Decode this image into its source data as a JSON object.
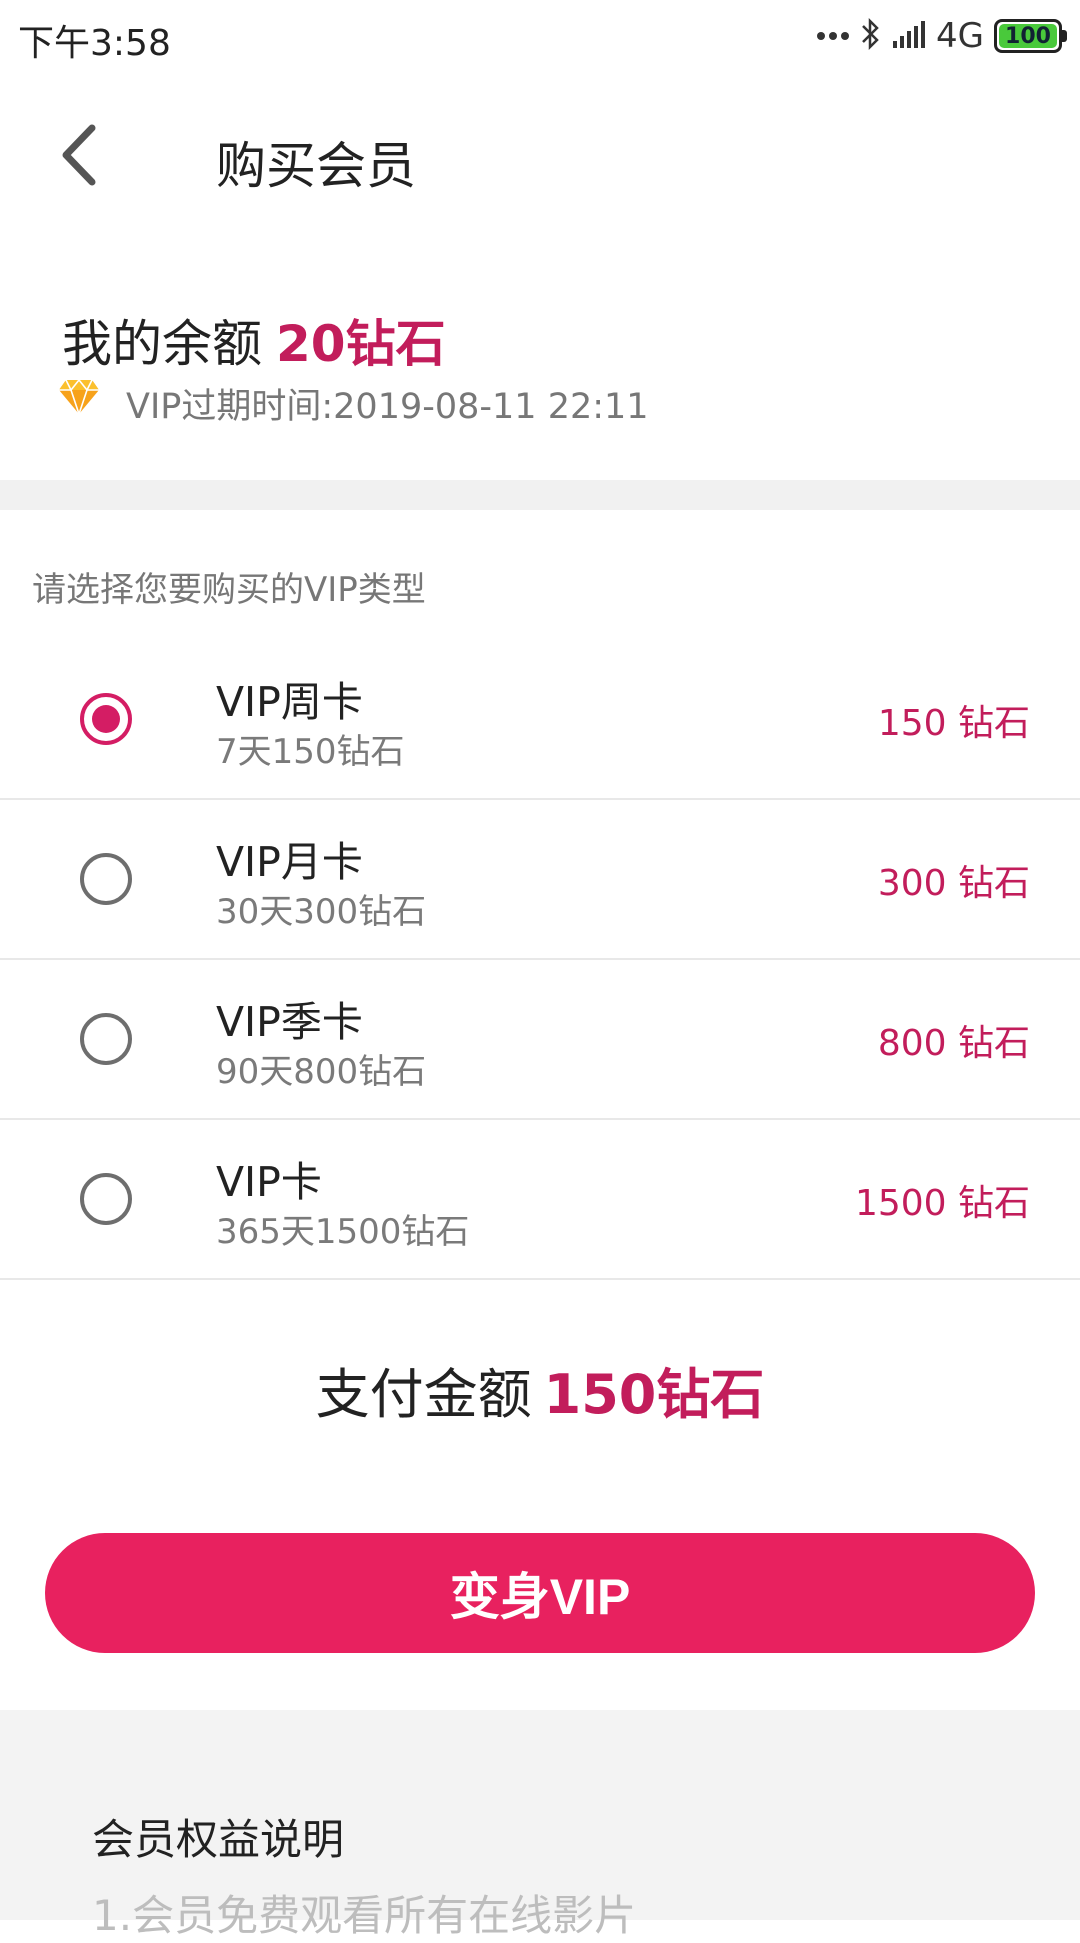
{
  "status_bar": {
    "time": "下午3:58",
    "network": "4G",
    "battery": "100"
  },
  "header": {
    "title": "购买会员"
  },
  "balance": {
    "label": "我的余额",
    "amount": "20钻石",
    "expire_text": "VIP过期时间:2019-08-11 22:11"
  },
  "select_prompt": "请选择您要购买的VIP类型",
  "options": [
    {
      "name": "VIP周卡",
      "desc": "7天150钻石",
      "price": "150 钻石",
      "selected": true
    },
    {
      "name": "VIP月卡",
      "desc": "30天300钻石",
      "price": "300 钻石",
      "selected": false
    },
    {
      "name": "VIP季卡",
      "desc": "90天800钻石",
      "price": "800 钻石",
      "selected": false
    },
    {
      "name": "VIP卡",
      "desc": "365天1500钻石",
      "price": "1500 钻石",
      "selected": false
    }
  ],
  "payment": {
    "label": "支付金额",
    "amount": "150钻石"
  },
  "action_button": "变身VIP",
  "benefits": {
    "title": "会员权益说明",
    "items": [
      "1.会员免费观看所有在线影片"
    ]
  },
  "colors": {
    "accent": "#e8215f",
    "price_text": "#c21d5b"
  }
}
